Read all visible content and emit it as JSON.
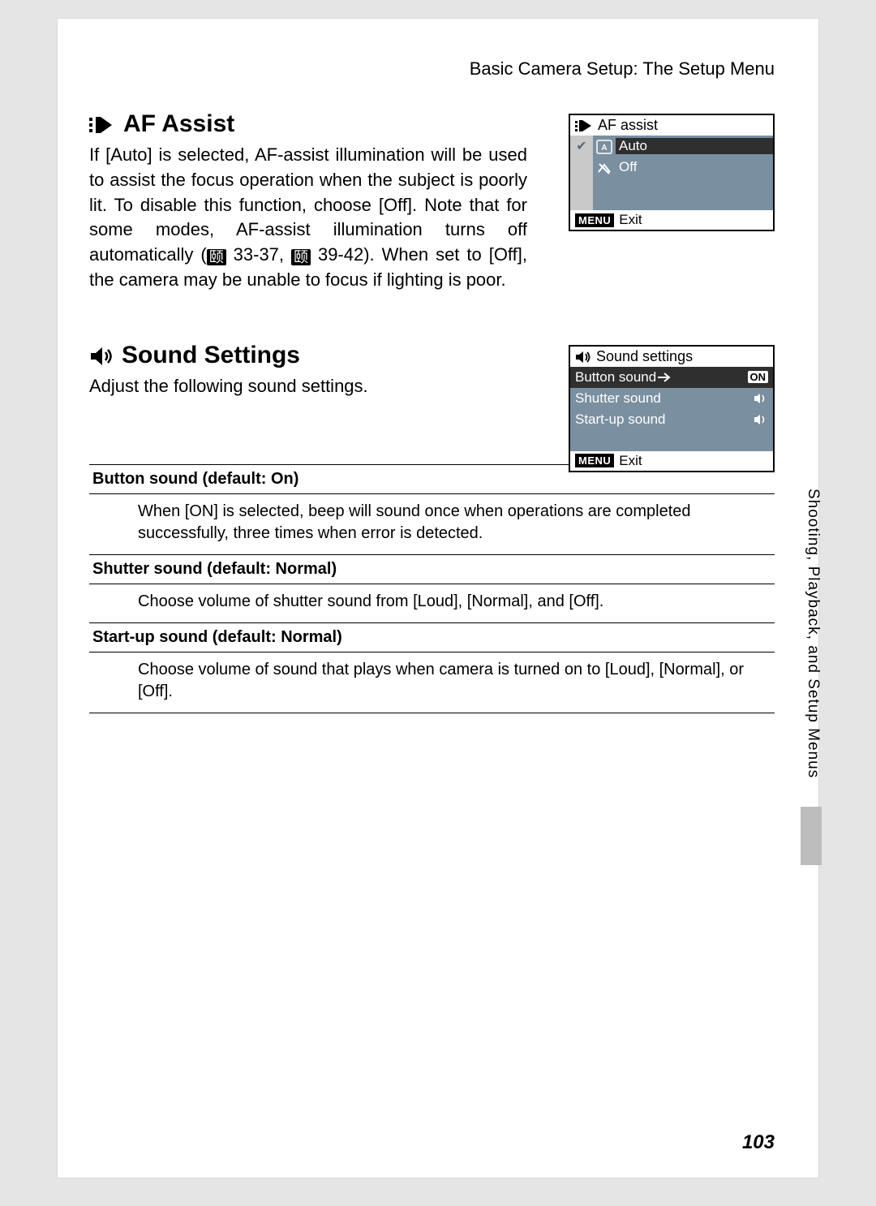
{
  "header": "Basic Camera Setup: The Setup Menu",
  "af": {
    "title": "AF Assist",
    "body_a": "If [Auto] is selected, AF-assist illumination will be used to assist the focus operation when the subject is poorly lit. To disable this function, choose [Off]. Note that for some modes, AF-assist illumination turns off automatically (",
    "ref1": " 33-37, ",
    "ref2": " 39-42). When set to [Off], the camera may be unable to focus if lighting is poor.",
    "screen": {
      "title": "AF assist",
      "opt1": "Auto",
      "opt2": "Off",
      "exit": "Exit"
    }
  },
  "sound": {
    "title": "Sound Settings",
    "body": "Adjust the following sound settings.",
    "screen": {
      "title": "Sound settings",
      "r1": "Button sound",
      "r1v": "ON",
      "r2": "Shutter sound",
      "r3": "Start-up sound",
      "exit": "Exit"
    }
  },
  "table": {
    "h1": "Button sound (default: On)",
    "d1": "When [ON] is selected, beep will sound once when operations are completed successfully, three times when error is detected.",
    "h2": "Shutter sound (default: Normal)",
    "d2": "Choose volume of shutter sound from [Loud], [Normal], and [Off].",
    "h3": "Start-up sound (default: Normal)",
    "d3": "Choose volume of sound that plays when camera is turned on to [Loud], [Normal], or [Off]."
  },
  "side": "Shooting, Playback, and Setup Menus",
  "page": "103"
}
